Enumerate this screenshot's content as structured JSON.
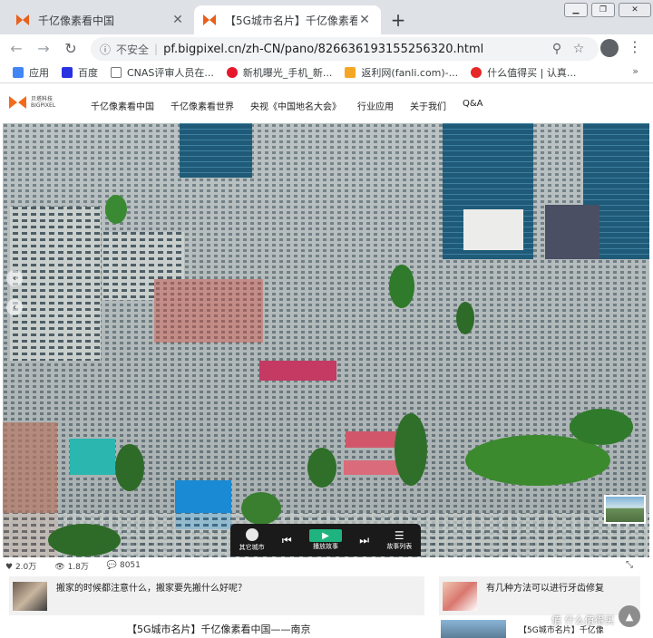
{
  "browser": {
    "tabs": [
      {
        "title": "千亿像素看中国",
        "active": false
      },
      {
        "title": "【5G城市名片】千亿像素看",
        "active": true
      }
    ],
    "url_security": "不安全",
    "url": "pf.bigpixel.cn/zh-CN/pano/826636193155256320.html",
    "bookmarks": [
      {
        "label": "应用",
        "color": "#4285f4"
      },
      {
        "label": "百度",
        "color": "#2932e1"
      },
      {
        "label": "CNAS评审人员在...",
        "color": "#555555"
      },
      {
        "label": "新机曝光_手机_新...",
        "color": "#e6162d"
      },
      {
        "label": "返利网(fanli.com)-...",
        "color": "#f5a623"
      },
      {
        "label": "什么值得买 | 认真...",
        "color": "#e62828"
      }
    ]
  },
  "site": {
    "logo_text": "BIGPIXEL",
    "logo_cn": "贝塔科技",
    "nav": [
      "千亿像素看中国",
      "千亿像素看世界",
      "央视《中国地名大会》",
      "行业应用",
      "关于我们",
      "Q&A"
    ]
  },
  "player": {
    "items": [
      "其它城市",
      "播放故事",
      "故事列表"
    ]
  },
  "stats": {
    "likes": "2.0万",
    "views": "1.8万",
    "comments": "8051"
  },
  "related": {
    "card1": "搬家的时候都注意什么，搬家要先搬什么好呢？",
    "card2": "有几种方法可以进行牙齿修复",
    "card3": "【5G城市名片】千亿像"
  },
  "page_title": "【5G城市名片】千亿像素看中国——南京",
  "watermark": "值 什么值得买"
}
